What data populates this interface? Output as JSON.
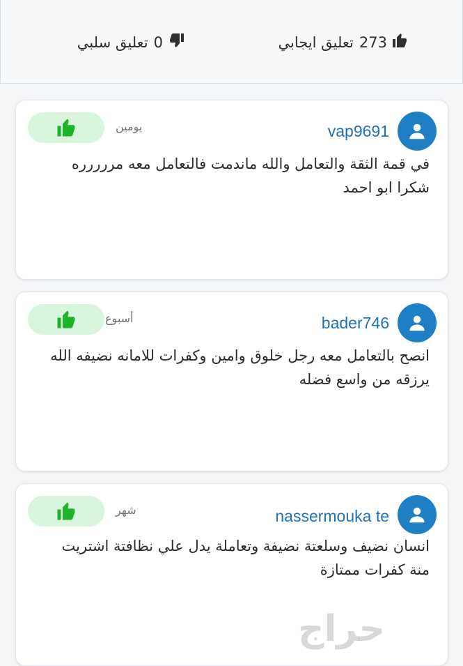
{
  "summary": {
    "positive": {
      "count": "273",
      "label": "تعليق ايجابي"
    },
    "negative": {
      "count": "0",
      "label": "تعليق سلبي"
    }
  },
  "comments": [
    {
      "username": "vap9691",
      "time": "يومين",
      "text": "في قمة الثقة والتعامل والله ماندمت فالتعامل معه مررررره شكرا ابو احمد"
    },
    {
      "username": "bader746",
      "time": "أسبوع",
      "text": "انصح بالتعامل معه رجل خلوق وامين وكفرات للامانه نضيفه الله يرزقه من واسع فضله"
    },
    {
      "username": "nassermouka te",
      "time": "شهر",
      "text": "انسان نضيف وسلعتة نضيفة وتعاملة يدل علي نظافتة اشتريت منة كفرات ممتازة"
    }
  ],
  "watermark": "حراج",
  "icons": {
    "positive": "thumbs-up-icon",
    "negative": "thumbs-down-icon",
    "avatar": "user-icon"
  },
  "colors": {
    "accent_blue": "#1f7fc4",
    "like_green": "#1fb32c",
    "like_bg": "#d9f5dd"
  }
}
